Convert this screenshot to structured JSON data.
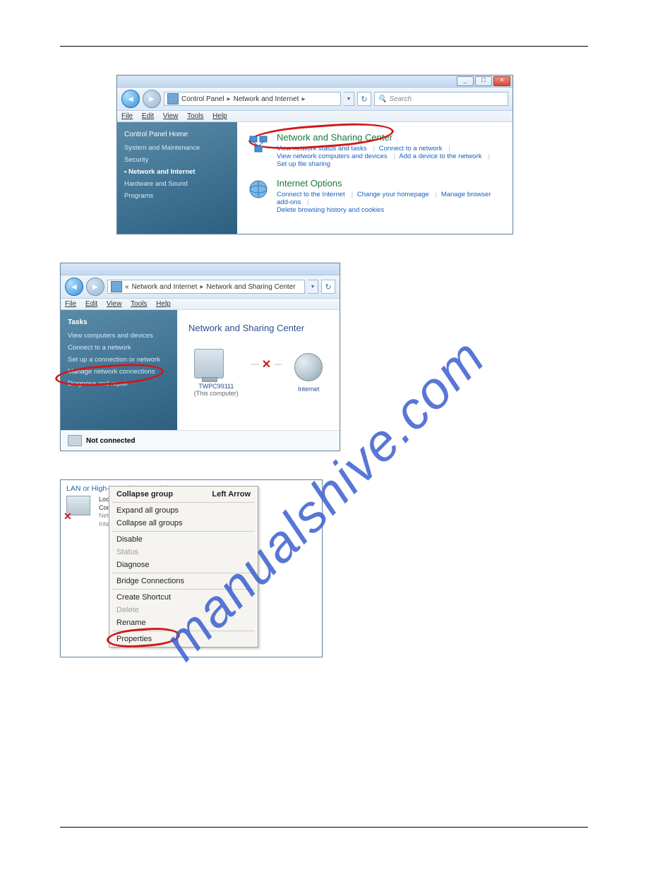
{
  "watermark": "manualshive.com",
  "window1": {
    "breadcrumb": [
      "Control Panel",
      "Network and Internet"
    ],
    "search_placeholder": "Search",
    "menu": {
      "file": "File",
      "edit": "Edit",
      "view": "View",
      "tools": "Tools",
      "help": "Help"
    },
    "sidebar": {
      "home": "Control Panel Home",
      "items": [
        "System and Maintenance",
        "Security",
        "Network and Internet",
        "Hardware and Sound",
        "Programs"
      ],
      "active_index": 2
    },
    "sections": [
      {
        "title": "Network and Sharing Center",
        "links_line1": [
          "View network status and tasks",
          "Connect to a network"
        ],
        "links_line2": [
          "View network computers and devices",
          "Add a device to the network",
          "Set up file sharing"
        ]
      },
      {
        "title": "Internet Options",
        "links_line1": [
          "Connect to the Internet",
          "Change your homepage",
          "Manage browser add-ons"
        ],
        "links_line2": [
          "Delete browsing history and cookies"
        ]
      }
    ]
  },
  "window2": {
    "breadcrumb_prefix": "«",
    "breadcrumb": [
      "Network and Internet",
      "Network and Sharing Center"
    ],
    "menu": {
      "file": "File",
      "edit": "Edit",
      "view": "View",
      "tools": "Tools",
      "help": "Help"
    },
    "sidebar": {
      "heading": "Tasks",
      "items": [
        "View computers and devices",
        "Connect to a network",
        "Set up a connection or network",
        "Manage network connections",
        "Diagnose and repair"
      ]
    },
    "main_title": "Network and Sharing Center",
    "pc_name": "TWPC99111",
    "pc_sub": "(This computer)",
    "internet_label": "Internet",
    "not_connected": "Not connected"
  },
  "window3": {
    "header": "LAN or High-Speed Internet (1)",
    "item": {
      "l1": "Local",
      "l2": "Conne",
      "l3": "Netwo",
      "l4": "Intel"
    },
    "menu": {
      "collapse_group": "Collapse group",
      "shortcut": "Left Arrow",
      "expand_all": "Expand all groups",
      "collapse_all": "Collapse all groups",
      "disable": "Disable",
      "status": "Status",
      "diagnose": "Diagnose",
      "bridge": "Bridge Connections",
      "create_shortcut": "Create Shortcut",
      "delete": "Delete",
      "rename": "Rename",
      "properties": "Properties"
    }
  }
}
